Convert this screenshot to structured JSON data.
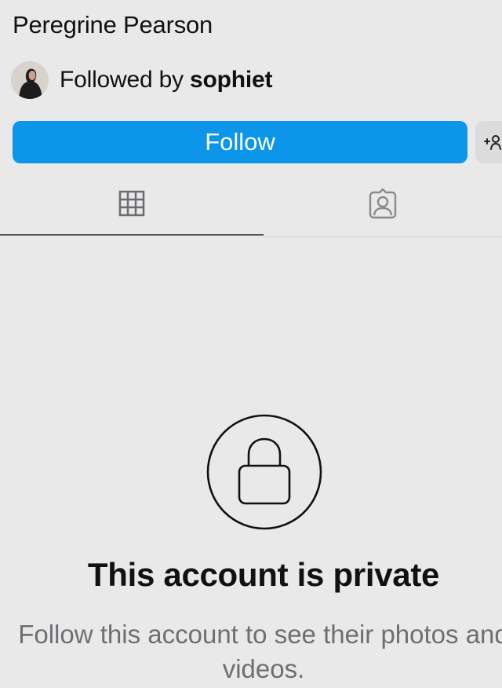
{
  "profile": {
    "name": "Peregrine Pearson"
  },
  "followed_by": {
    "prefix": "Followed by",
    "username": "sophiet"
  },
  "actions": {
    "follow_label": "Follow",
    "suggest_icon": "add-person-icon"
  },
  "tabs": [
    {
      "name": "posts-grid",
      "icon": "grid-icon",
      "selected": true
    },
    {
      "name": "tagged",
      "icon": "tagged-person-icon",
      "selected": false
    }
  ],
  "private_notice": {
    "icon": "lock-icon",
    "title": "This account is private",
    "subtitle": "Follow this account to see their photos and videos."
  },
  "colors": {
    "background": "#e9e9ea",
    "follow_button": "#0b96ea",
    "text": "#111111",
    "secondary_text": "#6e6e73"
  }
}
